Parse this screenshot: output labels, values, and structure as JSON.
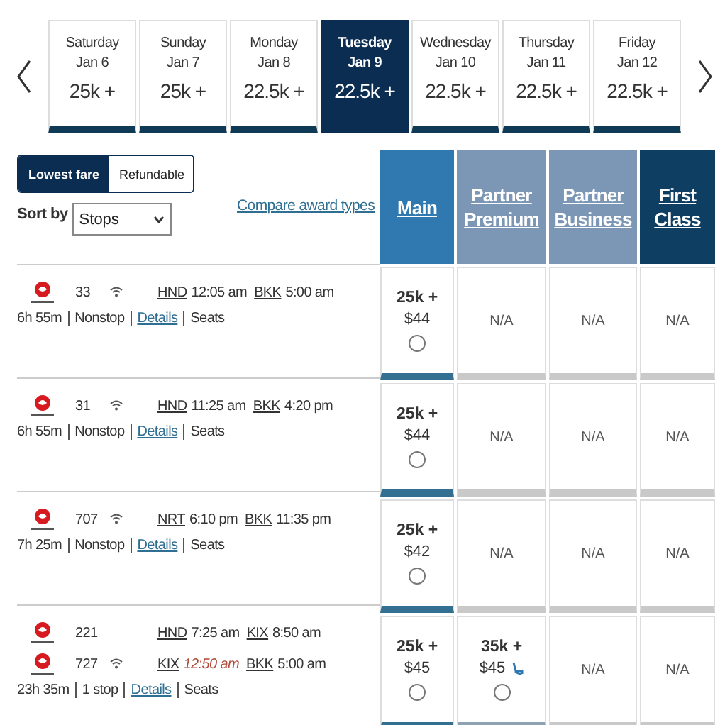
{
  "dates": [
    {
      "day": "Saturday",
      "date": "Jan 6",
      "price": "25k +",
      "selected": false
    },
    {
      "day": "Sunday",
      "date": "Jan 7",
      "price": "25k +",
      "selected": false
    },
    {
      "day": "Monday",
      "date": "Jan 8",
      "price": "22.5k +",
      "selected": false
    },
    {
      "day": "Tuesday",
      "date": "Jan 9",
      "price": "22.5k +",
      "selected": true
    },
    {
      "day": "Wednesday",
      "date": "Jan 10",
      "price": "22.5k +",
      "selected": false
    },
    {
      "day": "Thursday",
      "date": "Jan 11",
      "price": "22.5k +",
      "selected": false
    },
    {
      "day": "Friday",
      "date": "Jan 12",
      "price": "22.5k +",
      "selected": false
    }
  ],
  "fare_toggle": [
    {
      "label": "Lowest fare",
      "selected": true
    },
    {
      "label": "Refundable",
      "selected": false
    }
  ],
  "compare_link": "Compare award types",
  "sort": {
    "label": "Sort by",
    "value": "Stops"
  },
  "columns": [
    {
      "label": "Main",
      "color": "#2f79b0"
    },
    {
      "label": "Partner Premium",
      "color": "#7c97b6"
    },
    {
      "label": "Partner Business",
      "color": "#7c97b6"
    },
    {
      "label": "First Class",
      "color": "#0e3f63"
    }
  ],
  "rows": [
    {
      "segments": [
        {
          "flight": "33",
          "wifi": true,
          "from": "HND",
          "depart": "12:05 am",
          "next_day": false,
          "to": "BKK",
          "arrive": "5:00 am"
        }
      ],
      "duration": "6h 55m",
      "stops": "Nonstop",
      "details": "Details",
      "seats": "Seats",
      "cells": [
        {
          "kind": "fare",
          "points": "25k +",
          "price": "$44",
          "selected": false,
          "seat_icon": false
        },
        {
          "kind": "na",
          "text": "N/A"
        },
        {
          "kind": "na",
          "text": "N/A"
        },
        {
          "kind": "na",
          "text": "N/A"
        }
      ]
    },
    {
      "segments": [
        {
          "flight": "31",
          "wifi": true,
          "from": "HND",
          "depart": "11:25 am",
          "next_day": false,
          "to": "BKK",
          "arrive": "4:20 pm"
        }
      ],
      "duration": "6h 55m",
      "stops": "Nonstop",
      "details": "Details",
      "seats": "Seats",
      "cells": [
        {
          "kind": "fare",
          "points": "25k +",
          "price": "$44",
          "selected": false,
          "seat_icon": false
        },
        {
          "kind": "na",
          "text": "N/A"
        },
        {
          "kind": "na",
          "text": "N/A"
        },
        {
          "kind": "na",
          "text": "N/A"
        }
      ]
    },
    {
      "segments": [
        {
          "flight": "707",
          "wifi": true,
          "from": "NRT",
          "depart": "6:10 pm",
          "next_day": false,
          "to": "BKK",
          "arrive": "11:35 pm"
        }
      ],
      "duration": "7h 25m",
      "stops": "Nonstop",
      "details": "Details",
      "seats": "Seats",
      "cells": [
        {
          "kind": "fare",
          "points": "25k +",
          "price": "$42",
          "selected": false,
          "seat_icon": false
        },
        {
          "kind": "na",
          "text": "N/A"
        },
        {
          "kind": "na",
          "text": "N/A"
        },
        {
          "kind": "na",
          "text": "N/A"
        }
      ]
    },
    {
      "segments": [
        {
          "flight": "221",
          "wifi": false,
          "from": "HND",
          "depart": "7:25 am",
          "next_day": false,
          "to": "KIX",
          "arrive": "8:50 am"
        },
        {
          "flight": "727",
          "wifi": true,
          "from": "KIX",
          "depart": "12:50 am",
          "next_day": true,
          "to": "BKK",
          "arrive": "5:00 am"
        }
      ],
      "duration": "23h 35m",
      "stops": "1 stop",
      "details": "Details",
      "seats": "Seats",
      "cells": [
        {
          "kind": "fare",
          "points": "25k +",
          "price": "$45",
          "selected": false,
          "seat_icon": false
        },
        {
          "kind": "fare",
          "points": "35k +",
          "price": "$45",
          "selected": false,
          "seat_icon": true
        },
        {
          "kind": "na",
          "text": "N/A"
        },
        {
          "kind": "na",
          "text": "N/A"
        }
      ]
    }
  ]
}
